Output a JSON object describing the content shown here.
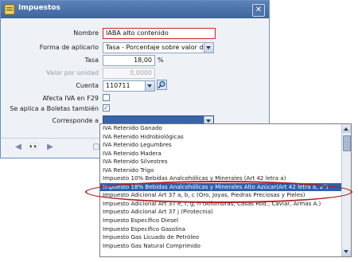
{
  "window": {
    "title": "Impuestos",
    "close_glyph": "✕"
  },
  "form": {
    "nombre": {
      "label": "Nombre",
      "value": "IABA alto contenido"
    },
    "forma": {
      "label": "Forma de aplicarlo",
      "value": "Tasa - Porcentaje sobre valor del pr"
    },
    "tasa": {
      "label": "Tasa",
      "value": "18,00",
      "unit": "%"
    },
    "valor": {
      "label": "Valor por unidad",
      "value": "0,0000"
    },
    "cuenta": {
      "label": "Cuenta",
      "value": "110711"
    },
    "afecta": {
      "label": "Afecta IVA en F29",
      "checked": false
    },
    "boletas": {
      "label": "Se aplica a Boletas también",
      "checked": true,
      "check_glyph": "✓"
    },
    "corresponde": {
      "label": "Corresponde a",
      "value": ""
    }
  },
  "toolbar": {
    "first_glyph": "◀",
    "find_glyph": "👀",
    "next_glyph": "▶",
    "doc_glyph": "▢"
  },
  "dropdown": {
    "options": [
      "IVA Retenido Ganado",
      "IVA Retenido Hidrobiológicas",
      "IVA Retenido Legumbres",
      "IVA Retenido Madera",
      "IVA Retenido Silvestres",
      "IVA Retenido Trigo",
      "Impuesto 10% Bebidas Analcohólicas y Minerales (Art 42 letra a)",
      "Impuesto 18% Bebidas Analcohólicas y Minerales Alto Azúcar(Art 42 letra a, 2°)",
      "Impuesto Adicional Art 37 a, b, c (Oro, Joyas, Piedras Preciosas y Pieles)",
      "Impuesto Adicional Art 37 e, f, g, h (Alfombras, Casas Rod., Caviar, Armas A.)",
      "Impuesto Adicional Art 37 j (Pirotecnia)",
      "Impuesto Específico Diesel",
      "Impuesto Específico Gasolina",
      "Impuesto Gas Licuado de Petróleo",
      "Impuesto Gas Natural Comprimido"
    ],
    "selected_index": 7
  },
  "colors": {
    "title_bar": "#4a70a8",
    "selection": "#2f5fae",
    "highlight_ring": "#b32020",
    "required_border": "#d02424"
  }
}
